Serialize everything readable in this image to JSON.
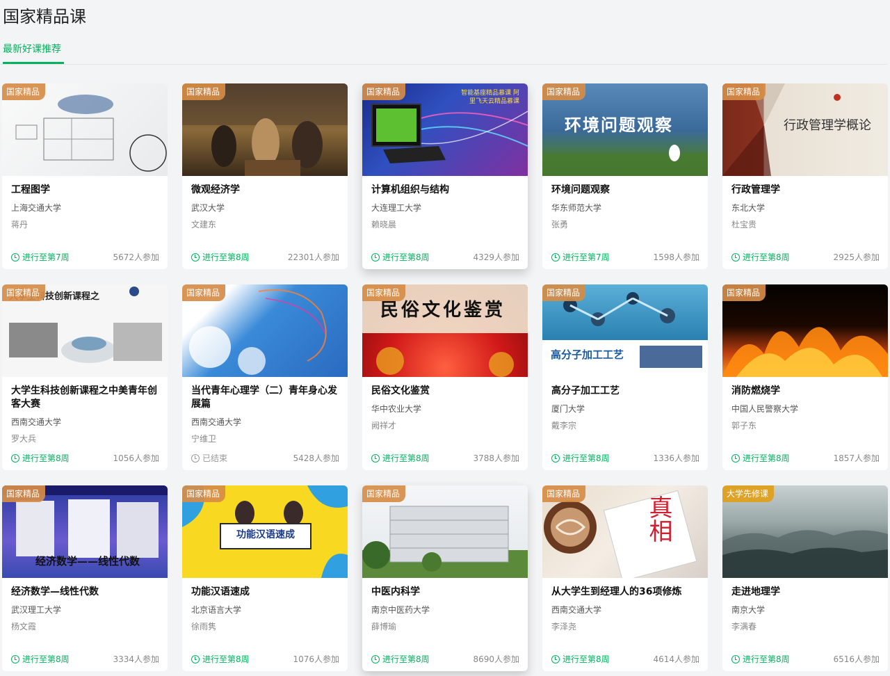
{
  "page": {
    "title": "国家精品课",
    "tab": "最新好课推荐"
  },
  "cards": [
    {
      "badge": "国家精品",
      "name": "工程图学",
      "university": "上海交通大学",
      "teacher": "蒋丹",
      "status": "进行至第7周",
      "participants": "5672人参加",
      "thumb_text": ""
    },
    {
      "badge": "国家精品",
      "name": "微观经济学",
      "university": "武汉大学",
      "teacher": "文建东",
      "status": "进行至第8周",
      "participants": "22301人参加",
      "thumb_text": ""
    },
    {
      "badge": "国家精品",
      "name": "计算机组织与结构",
      "university": "大连理工大学",
      "teacher": "赖晓晨",
      "status": "进行至第8周",
      "participants": "4329人参加",
      "thumb_text": "智能基座精品慕课 阿里飞天云精品慕课"
    },
    {
      "badge": "国家精品",
      "name": "环境问题观察",
      "university": "华东师范大学",
      "teacher": "张勇",
      "status": "进行至第7周",
      "participants": "1598人参加",
      "thumb_text": "环境问题观察"
    },
    {
      "badge": "国家精品",
      "name": "行政管理学",
      "university": "东北大学",
      "teacher": "杜宝贵",
      "status": "进行至第8周",
      "participants": "2925人参加",
      "thumb_text": "行政管理学概论"
    },
    {
      "badge": "国家精品",
      "name": "大学生科技创新课程之中美青年创客大赛",
      "university": "西南交通大学",
      "teacher": "罗大兵",
      "status": "进行至第8周",
      "participants": "1056人参加",
      "thumb_text": "大学生科技创新课程之"
    },
    {
      "badge": "国家精品",
      "name": "当代青年心理学（二）青年身心发展篇",
      "university": "西南交通大学",
      "teacher": "宁维卫",
      "status": "已结束",
      "participants": "5428人参加",
      "thumb_text": ""
    },
    {
      "badge": "国家精品",
      "name": "民俗文化鉴赏",
      "university": "华中农业大学",
      "teacher": "阙祥才",
      "status": "进行至第8周",
      "participants": "3788人参加",
      "thumb_text": "民俗文化鉴赏"
    },
    {
      "badge": "国家精品",
      "name": "高分子加工工艺",
      "university": "厦门大学",
      "teacher": "戴李宗",
      "status": "进行至第8周",
      "participants": "1336人参加",
      "thumb_text": "高分子加工工艺"
    },
    {
      "badge": "国家精品",
      "name": "消防燃烧学",
      "university": "中国人民警察大学",
      "teacher": "郭子东",
      "status": "进行至第8周",
      "participants": "1857人参加",
      "thumb_text": ""
    },
    {
      "badge": "国家精品",
      "name": "经济数学—线性代数",
      "university": "武汉理工大学",
      "teacher": "杨文霞",
      "status": "进行至第8周",
      "participants": "3334人参加",
      "thumb_text": "经济数学——线性代数"
    },
    {
      "badge": "国家精品",
      "name": "功能汉语速成",
      "university": "北京语言大学",
      "teacher": "徐雨隽",
      "status": "进行至第8周",
      "participants": "1076人参加",
      "thumb_text": "功能汉语速成"
    },
    {
      "badge": "国家精品",
      "name": "中医内科学",
      "university": "南京中医药大学",
      "teacher": "薛博瑜",
      "status": "进行至第8周",
      "participants": "8690人参加",
      "thumb_text": ""
    },
    {
      "badge": "国家精品",
      "name": "从大学生到经理人的36项修炼",
      "university": "西南交通大学",
      "teacher": "李泽尧",
      "status": "进行至第8周",
      "participants": "4614人参加",
      "thumb_text": "真相"
    },
    {
      "badge": "大学先修课",
      "name": "走进地理学",
      "university": "南京大学",
      "teacher": "李满春",
      "status": "进行至第8周",
      "participants": "6516人参加",
      "thumb_text": ""
    }
  ]
}
